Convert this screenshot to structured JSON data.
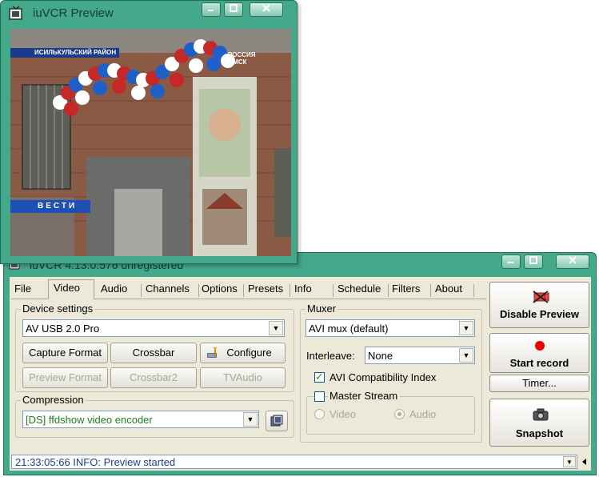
{
  "preview_window": {
    "title": "iuVCR Preview",
    "overlay_region": "ИСИЛЬКУЛЬСКИЙ РАЙОН",
    "overlay_channel_line1": "РОССИЯ",
    "overlay_channel_line2": "ОМСК",
    "overlay_logo": "ВЕСТИ"
  },
  "main_window": {
    "title": "iuVCR 4.13.0.576 unregistered"
  },
  "tabs": [
    "File",
    "Video",
    "Audio",
    "Channels",
    "Options",
    "Presets",
    "Info",
    "Schedule",
    "Filters",
    "About"
  ],
  "selected_tab": "Video",
  "device_settings": {
    "label": "Device settings",
    "device": "AV USB 2.0 Pro",
    "buttons": {
      "capture_format": "Capture Format",
      "crossbar": "Crossbar",
      "configure": "Configure",
      "preview_format": "Preview Format",
      "crossbar2": "Crossbar2",
      "tvaudio": "TVAudio"
    }
  },
  "compression": {
    "label": "Compression",
    "codec": "[DS] ffdshow video encoder",
    "codec_color": "#1f7d1f"
  },
  "muxer": {
    "label": "Muxer",
    "muxer": "AVI mux (default)",
    "interleave_label": "Interleave:",
    "interleave": "None",
    "avi_index_label": "AVI Compatibility Index",
    "avi_index_checked": true,
    "master_stream_label": "Master Stream",
    "master_stream_checked": false,
    "radio_video": "Video",
    "radio_audio": "Audio",
    "radio_selected": "Audio"
  },
  "actions": {
    "disable_preview": "Disable Preview",
    "start_record": "Start record",
    "timer": "Timer...",
    "snapshot": "Snapshot"
  },
  "status": {
    "text": "21:33:05:66 INFO: Preview started"
  },
  "colors": {
    "window_frame": "#44a98a",
    "client": "#ece9d8",
    "record_dot": "#e60000"
  }
}
